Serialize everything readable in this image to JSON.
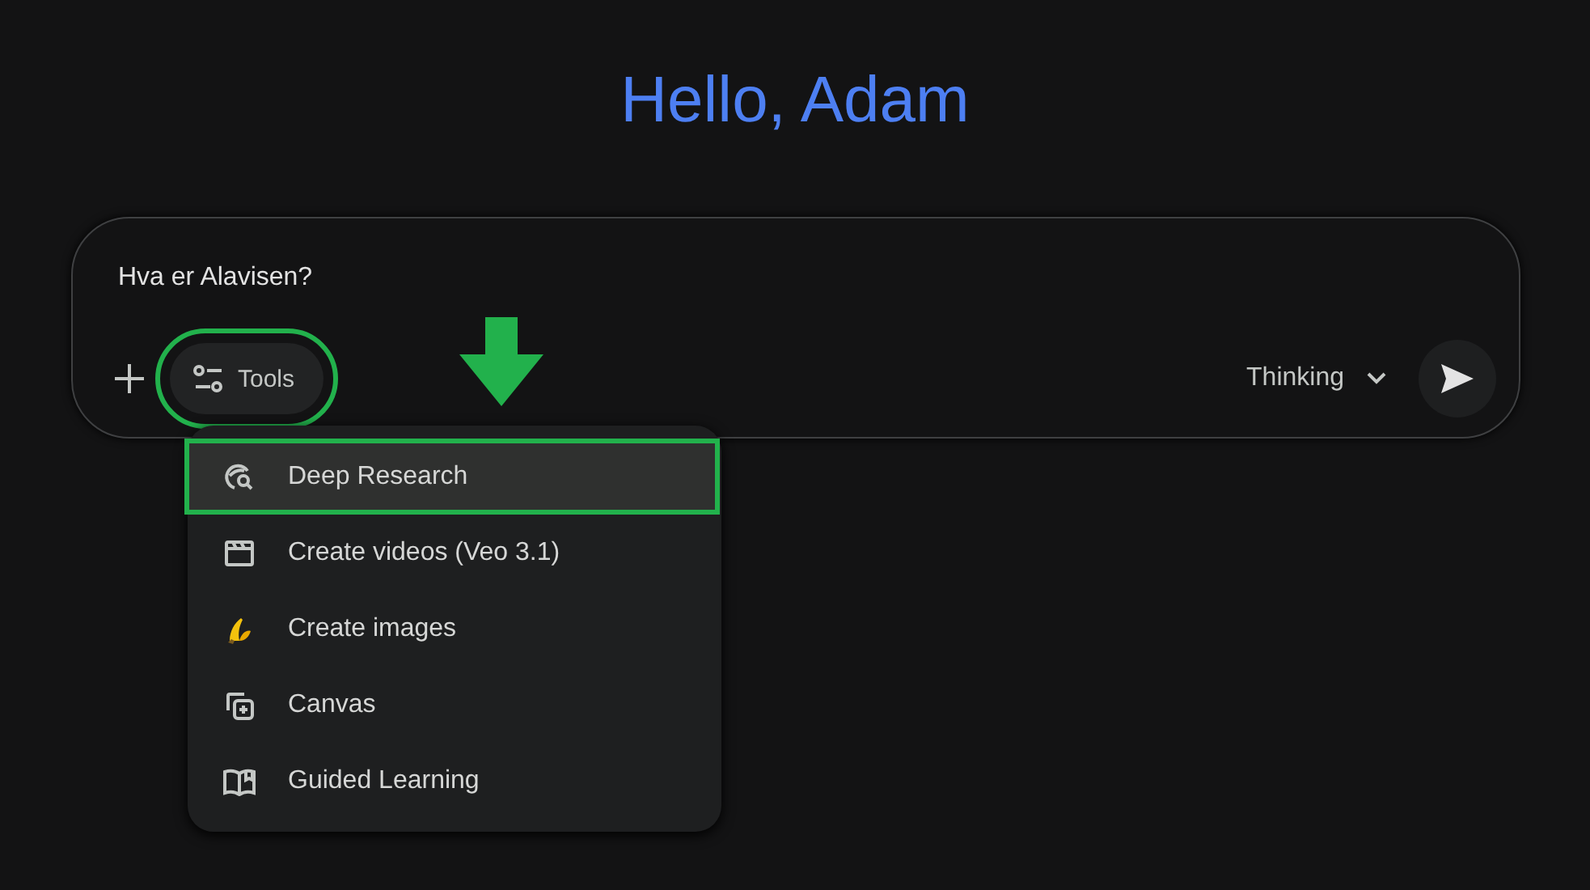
{
  "greeting": "Hello, Adam",
  "composer": {
    "value": "Hva er Alavisen?",
    "tools_label": "Tools",
    "tools_outlined": true,
    "mode": "Thinking"
  },
  "annotation_arrow": true,
  "tools_menu": [
    {
      "kind": "research",
      "label": "Deep Research",
      "selected": true,
      "outlined": true
    },
    {
      "kind": "video",
      "label": "Create videos (Veo 3.1)",
      "selected": false,
      "outlined": false
    },
    {
      "kind": "image",
      "label": "Create images",
      "selected": false,
      "outlined": false
    },
    {
      "kind": "canvas",
      "label": "Canvas",
      "selected": false,
      "outlined": false
    },
    {
      "kind": "learning",
      "label": "Guided Learning",
      "selected": false,
      "outlined": false
    }
  ]
}
